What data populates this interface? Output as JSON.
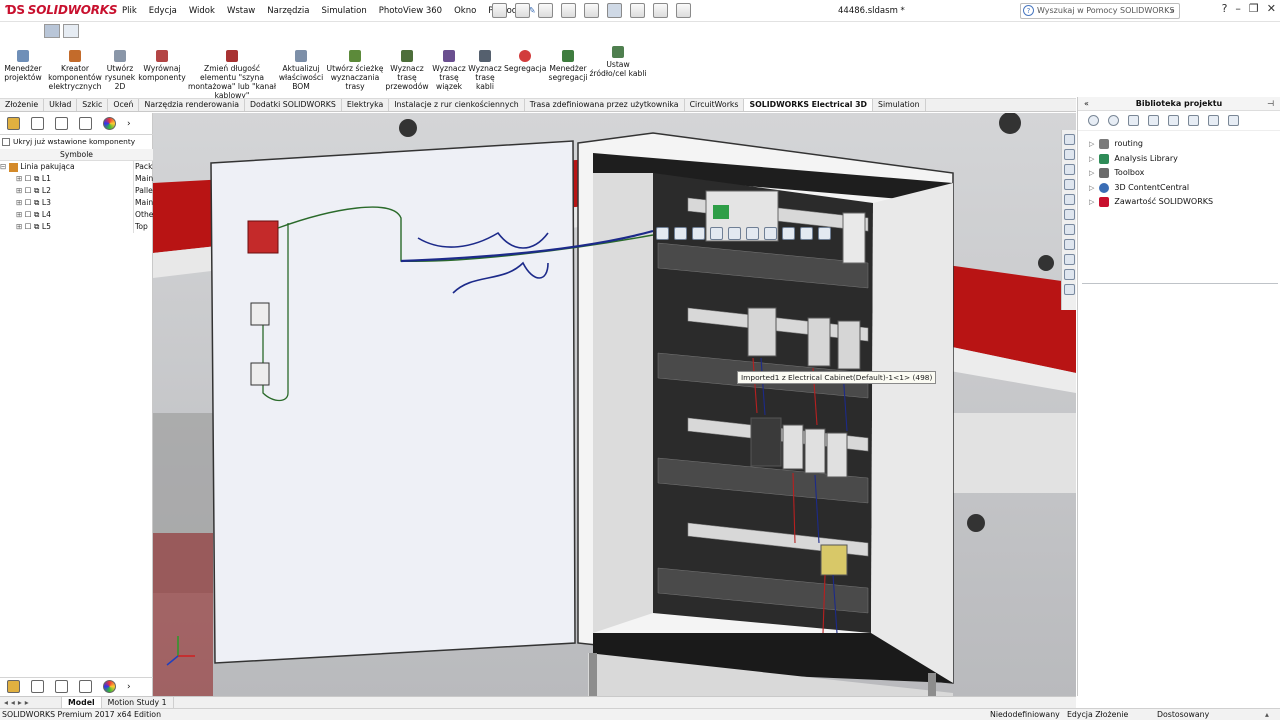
{
  "app": {
    "brand": "SOLIDWORKS",
    "document_title": "44486.sldasm *",
    "help_placeholder": "Wyszukaj w Pomocy SOLIDWORKS",
    "help_icon": "help-question-icon"
  },
  "menu": [
    "Plik",
    "Edycja",
    "Widok",
    "Wstaw",
    "Narzędzia",
    "Simulation",
    "PhotoView 360",
    "Okno",
    "Pomoc"
  ],
  "window_buttons": [
    "?",
    "–",
    "❐",
    "✕"
  ],
  "ribbon": {
    "buttons": [
      {
        "label": "Menedżer projektów",
        "icon": "project-manager-icon"
      },
      {
        "label": "Kreator komponentów elektrycznych",
        "icon": "component-wizard-icon"
      },
      {
        "label": "Utwórz rysunek 2D",
        "icon": "drawing-2d-icon"
      },
      {
        "label": "Wyrównaj komponenty",
        "icon": "align-components-icon"
      },
      {
        "label": "Zmień długość elementu \"szyna montażowa\" lub \"kanał kablowy\"",
        "icon": "rail-length-icon"
      },
      {
        "label": "Aktualizuj właściwości BOM",
        "icon": "bom-update-icon"
      },
      {
        "label": "Utwórz ścieżkę wyznaczania trasy",
        "icon": "route-path-icon"
      },
      {
        "label": "Wyznacz trasę przewodów",
        "icon": "route-wires-icon"
      },
      {
        "label": "Wyznacz trasę wiązek",
        "icon": "route-harness-icon"
      },
      {
        "label": "Wyznacz trasę kabli",
        "icon": "route-cables-icon"
      },
      {
        "label": "Segregacja",
        "icon": "segregation-icon"
      },
      {
        "label": "Menedżer segregacji",
        "icon": "segregation-manager-icon"
      },
      {
        "label": "Ustaw źródło/cel kabli",
        "icon": "cable-source-target-icon"
      }
    ]
  },
  "tabs": [
    "Złożenie",
    "Układ",
    "Szkic",
    "Oceń",
    "Narzędzia renderowania",
    "Dodatki SOLIDWORKS",
    "Elektryka",
    "Instalacje z rur cienkościennych",
    "Trasa zdefiniowana przez użytkownika",
    "CircuitWorks",
    "SOLIDWORKS Electrical 3D",
    "Simulation"
  ],
  "active_tab": "SOLIDWORKS Electrical 3D",
  "left_panel": {
    "checkbox_label": "Ukryj już wstawione komponenty",
    "column_header": "Symbole",
    "root": {
      "label": "Linia pakująca",
      "col2": "Pack"
    },
    "items": [
      {
        "label": "L1",
        "col2": "Main"
      },
      {
        "label": "L2",
        "col2": "Palle"
      },
      {
        "label": "L3",
        "col2": "Main"
      },
      {
        "label": "L4",
        "col2": "Othe"
      },
      {
        "label": "L5",
        "col2": "Top"
      }
    ]
  },
  "viewport": {
    "tooltip": "Imported1 z Electrical Cabinet(Default)-1<1> (498)"
  },
  "library": {
    "title": "Biblioteka projektu",
    "items": [
      {
        "label": "routing",
        "icon": "routing-icon",
        "color": "#7a7a7a"
      },
      {
        "label": "Analysis Library",
        "icon": "analysis-library-icon",
        "color": "#2e8b57"
      },
      {
        "label": "Toolbox",
        "icon": "toolbox-icon",
        "color": "#6b6b6b"
      },
      {
        "label": "3D ContentCentral",
        "icon": "content-central-icon",
        "color": "#3a6db5"
      },
      {
        "label": "Zawartość SOLIDWORKS",
        "icon": "solidworks-content-icon",
        "color": "#c8102e"
      }
    ]
  },
  "bottom_tabs": [
    "Model",
    "Motion Study 1"
  ],
  "status": {
    "edition": "SOLIDWORKS Premium 2017 x64 Edition",
    "definition": "Niedodefiniowany",
    "mode": "Edycja Złożenie",
    "units": "Dostosowany"
  },
  "colors": {
    "brand": "#c8102e",
    "conveyor_red": "#b81414",
    "wire_blue": "#1c2a8a"
  }
}
